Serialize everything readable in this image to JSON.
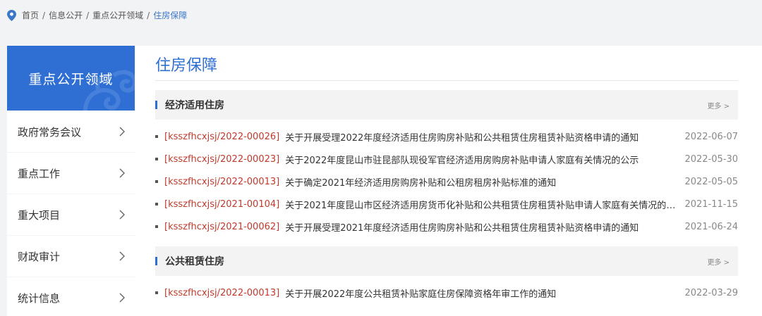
{
  "breadcrumb": {
    "items": [
      "首页",
      "信息公开",
      "重点公开领域"
    ],
    "separator": "/",
    "current": "住房保障"
  },
  "sidebar": {
    "header": "重点公开领域",
    "items": [
      {
        "label": "政府常务会议"
      },
      {
        "label": "重点工作"
      },
      {
        "label": "重大项目"
      },
      {
        "label": "财政审计"
      },
      {
        "label": "统计信息"
      }
    ]
  },
  "main": {
    "title": "住房保障",
    "sections": [
      {
        "title": "经济适用住房",
        "more": "更多 >",
        "rows": [
          {
            "code": "[ksszfhcxjsj/2022-00026]",
            "text": "关于开展受理2022年度经济适用住房购房补贴和公共租赁住房租赁补贴资格申请的通知",
            "date": "2022-06-07"
          },
          {
            "code": "[ksszfhcxjsj/2022-00023]",
            "text": "关于2022年度昆山市驻昆部队现役军官经济适用房购房补贴申请人家庭有关情况的公示",
            "date": "2022-05-30"
          },
          {
            "code": "[ksszfhcxjsj/2022-00013]",
            "text": "关于确定2021年经济适用房购房补贴和公租房租房补贴标准的通知",
            "date": "2022-05-05"
          },
          {
            "code": "[ksszfhcxjsj/2021-00104]",
            "text": "关于2021年度昆山市区经济适用房货币化补贴和公共租赁住房租赁补贴申请人家庭有关情况的公...",
            "date": "2021-11-15"
          },
          {
            "code": "[ksszfhcxjsj/2021-00062]",
            "text": "关于开展受理2021年度经济适用住房购房补贴和公共租赁住房租赁补贴资格申请的通知",
            "date": "2021-06-24"
          }
        ]
      },
      {
        "title": "公共租赁住房",
        "more": "更多 >",
        "rows": [
          {
            "code": "[ksszfhcxjsj/2022-00013]",
            "text": "关于开展2022年度公共租赁补贴家庭住房保障资格年审工作的通知",
            "date": "2022-03-29"
          }
        ]
      }
    ]
  },
  "colors": {
    "accent": "#2f6fd3",
    "code_red": "#c0392b",
    "date_gray": "#888888"
  },
  "icons": {
    "breadcrumb": "location-pin-icon",
    "sidebar_item": "chevron-right-icon"
  }
}
